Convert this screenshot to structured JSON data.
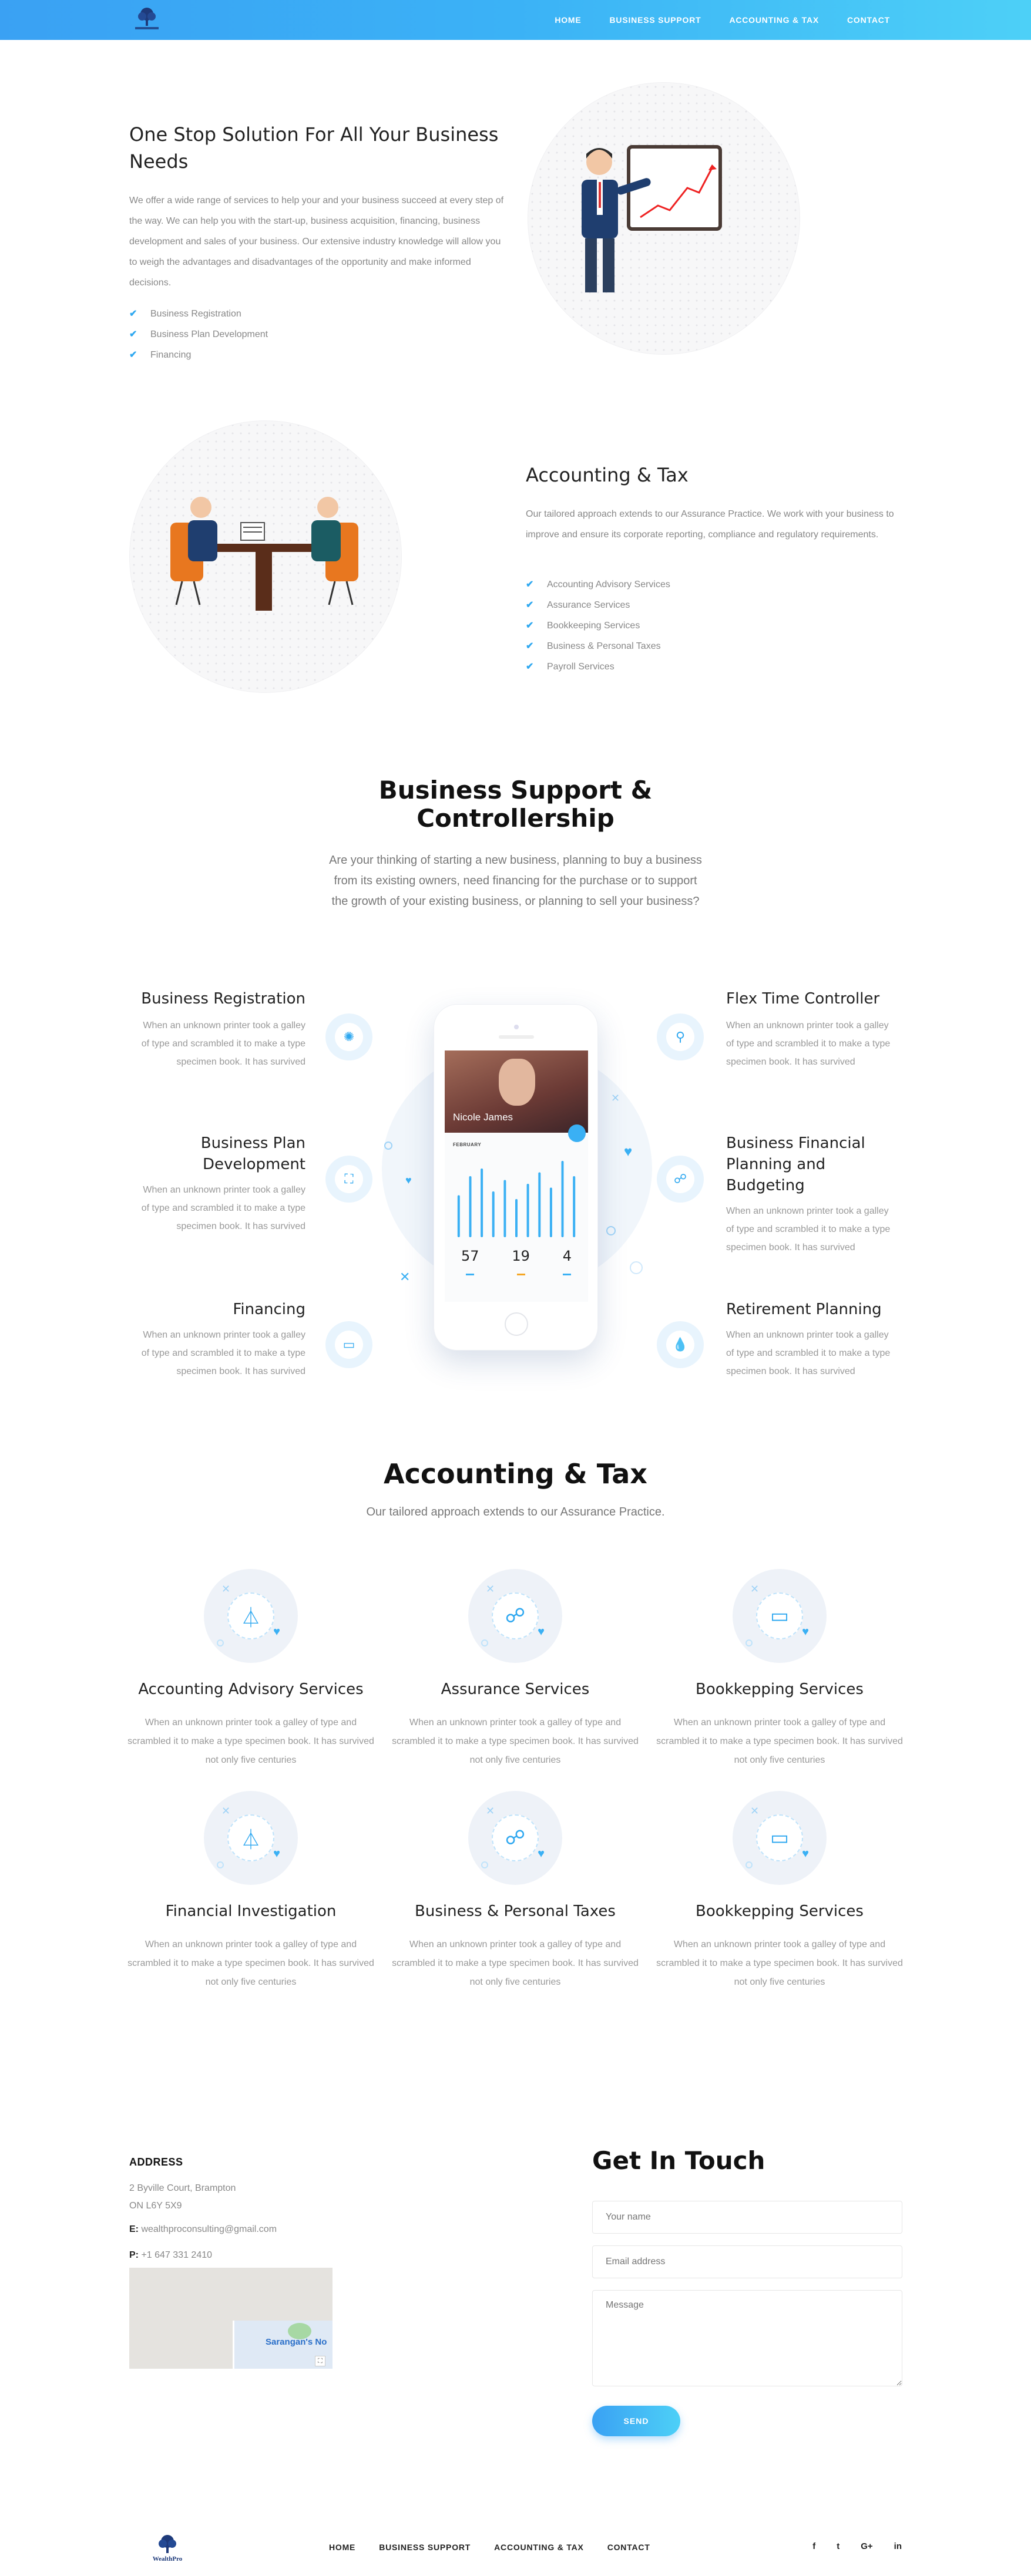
{
  "nav": {
    "logo_text": "WealthPro",
    "links": [
      "HOME",
      "BUSINESS SUPPORT",
      "ACCOUNTING & TAX",
      "CONTACT"
    ]
  },
  "intro": {
    "title": "One Stop Solution For All Your Business Needs",
    "body": "We offer a wide range of services to help your and your business succeed at every step of the way. We can help you with the start-up, business acquisition, financing, business development and sales of your business. Our extensive industry knowledge will allow you to weigh the advantages and disadvantages of the opportunity and make informed decisions.",
    "items": [
      "Business Registration",
      "Business Plan Development",
      "Financing"
    ]
  },
  "accounting_intro": {
    "title": "Accounting & Tax",
    "body": "Our tailored approach extends to our Assurance Practice. We work with your business to improve and ensure its corporate reporting, compliance and regulatory requirements.",
    "items": [
      "Accounting Advisory Services",
      "Assurance Services",
      "Bookkeeping Services",
      "Business & Personal Taxes",
      "Payroll Services"
    ]
  },
  "support": {
    "title": "Business Support & Controllership",
    "subtitle": "Are your thinking of starting a new business, planning to buy a business from its existing owners, need financing for the purchase or to support the growth of your existing business, or planning to sell your business?",
    "left": [
      {
        "title": "Business Registration",
        "text": "When an unknown printer took a galley of type and scrambled it to make a type specimen book. It has survived",
        "icon": "brain-icon"
      },
      {
        "title": "Business Plan Development",
        "text": "When an unknown printer took a galley of type and scrambled it to make a type specimen book. It has survived",
        "icon": "org-chart-icon"
      },
      {
        "title": "Financing",
        "text": "When an unknown printer took a galley of type and scrambled it to make a type specimen book. It has survived",
        "icon": "laptop-icon"
      }
    ],
    "right": [
      {
        "title": "Flex Time Controller",
        "text": "When an unknown printer took a galley of type and scrambled it to make a type specimen book. It has survived",
        "icon": "location-pin-icon"
      },
      {
        "title": "Business Financial Planning and Budgeting",
        "text": "When an unknown printer took a galley of type and scrambled it to make a type specimen book. It has survived",
        "icon": "handshake-icon"
      },
      {
        "title": "Retirement Planning",
        "text": "When an unknown printer took a galley of type and scrambled it to make a type specimen book. It has survived",
        "icon": "drop-icon"
      }
    ],
    "phone": {
      "profile_name": "Nicole James",
      "month": "FEBRUARY",
      "chart_bars": [
        0.55,
        0.8,
        0.9,
        0.6,
        0.75,
        0.5,
        0.7,
        0.85,
        0.65,
        1.0,
        0.8
      ],
      "stats": [
        "57",
        "19",
        "4"
      ],
      "stat_colors": [
        "#3ab0f4",
        "#f5a623",
        "#3ab0f4"
      ]
    }
  },
  "accounting": {
    "title": "Accounting & Tax",
    "subtitle": "Our tailored approach extends to our Assurance Practice.",
    "services": [
      {
        "name": "Accounting Advisory Services",
        "text": "When an unknown printer took a galley of type and scrambled it to make a type specimen book. It has survived not only five centuries",
        "icon": "compass-icon"
      },
      {
        "name": "Assurance Services",
        "text": "When an unknown printer took a galley of type and scrambled it to make a type specimen book. It has survived not only five centuries",
        "icon": "handshake-icon"
      },
      {
        "name": "Bookkepping Services",
        "text": "When an unknown printer took a galley of type and scrambled it to make a type specimen book. It has survived not only five centuries",
        "icon": "monitor-icon"
      },
      {
        "name": "Financial Investigation",
        "text": "When an unknown printer took a galley of type and scrambled it to make a type specimen book. It has survived not only five centuries",
        "icon": "compass-icon"
      },
      {
        "name": "Business & Personal Taxes",
        "text": "When an unknown printer took a galley of type and scrambled it to make a type specimen book. It has survived not only five centuries",
        "icon": "handshake-icon"
      },
      {
        "name": "Bookkepping Services",
        "text": "When an unknown printer took a galley of type and scrambled it to make a type specimen book. It has survived not only five centuries",
        "icon": "monitor-icon"
      }
    ]
  },
  "contact": {
    "address_heading": "ADDRESS",
    "address_line1": "2 Byville Court, Brampton",
    "address_line2": "ON L6Y 5X9",
    "email_label": "E:",
    "email": "wealthproconsulting@gmail.com",
    "phone_label": "P:",
    "phone": "+1 647 331 2410",
    "map_label": "Sarangan's No",
    "form_title": "Get In Touch",
    "name_placeholder": "Your name",
    "email_placeholder": "Email address",
    "message_placeholder": "Message",
    "send_label": "SEND"
  },
  "footer": {
    "links": [
      "HOME",
      "BUSINESS SUPPORT",
      "ACCOUNTING & TAX",
      "CONTACT"
    ],
    "social": [
      "f",
      "t",
      "G+",
      "in"
    ],
    "social_icons": [
      "facebook-icon",
      "twitter-icon",
      "google-plus-icon",
      "linkedin-icon"
    ]
  }
}
